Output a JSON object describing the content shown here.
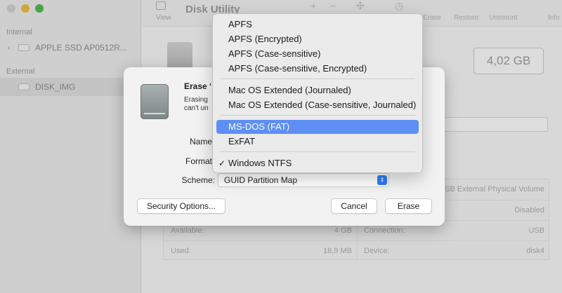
{
  "app": {
    "title": "Disk Utility"
  },
  "toolbar": {
    "view_label": "View",
    "add_symbol": "+",
    "remove_symbol": "−",
    "erase_label": "Erase",
    "restore_label": "Restore",
    "unmount_label": "Unmount",
    "info_label": "Info"
  },
  "sidebar": {
    "internal_header": "Internal",
    "internal_item": "APPLE SSD AP0512R...",
    "external_header": "External",
    "external_item": "DISK_IMG"
  },
  "main": {
    "capacity": "4,02 GB",
    "info": {
      "row1_right": "USB External Physical Volume",
      "row2_right": "Disabled",
      "available_label": "Available:",
      "available_value": "4 GB",
      "connection_label": "Connection:",
      "connection_value": "USB",
      "used_label": "Used:",
      "used_value": "18,9 MB",
      "device_label": "Device:",
      "device_value": "disk4"
    }
  },
  "sheet": {
    "title": "Erase “",
    "description": "Erasing can't un",
    "name_label": "Name",
    "format_label": "Format",
    "scheme_label": "Scheme:",
    "scheme_value": "GUID Partition Map",
    "security_button": "Security Options...",
    "cancel_button": "Cancel",
    "erase_button": "Erase"
  },
  "format_menu": {
    "items": [
      "APFS",
      "APFS (Encrypted)",
      "APFS (Case-sensitive)",
      "APFS (Case-sensitive, Encrypted)",
      "Mac OS Extended (Journaled)",
      "Mac OS Extended (Case-sensitive, Journaled)",
      "MS-DOS (FAT)",
      "ExFAT",
      "Windows NTFS"
    ],
    "highlighted": "MS-DOS (FAT)",
    "checked": "Windows NTFS",
    "check_mark": "✓"
  },
  "colors": {
    "highlight": "#5f8ff5",
    "stepper": "#2f7df6"
  }
}
